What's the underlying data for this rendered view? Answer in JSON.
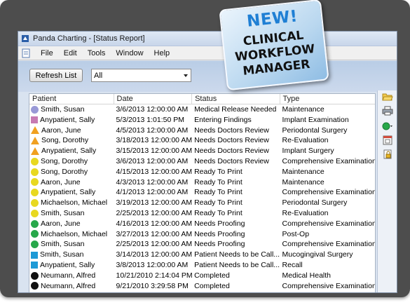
{
  "window": {
    "title": "Panda Charting - [Status Report]"
  },
  "menu": [
    "File",
    "Edit",
    "Tools",
    "Window",
    "Help"
  ],
  "toolbar": {
    "refresh_label": "Refresh List",
    "filter_value": "All"
  },
  "badge": {
    "line1": "NEW!",
    "line2": "CLINICAL",
    "line3": "WORKFLOW",
    "line4": "MANAGER"
  },
  "columns": [
    "Patient",
    "Date",
    "Status",
    "Type"
  ],
  "rows": [
    {
      "indicator": "circle",
      "color": "#9999d6",
      "patient": "Smith, Susan",
      "date": "3/6/2013 12:00:00 AM",
      "status": "Medical Release Needed",
      "type": "Maintenance"
    },
    {
      "indicator": "square",
      "color": "#c77ab3",
      "patient": "Anypatient, Sally",
      "date": "5/3/2013 1:01:50 PM",
      "status": "Entering  Findings",
      "type": "Implant Examination"
    },
    {
      "indicator": "triangle",
      "color": "#f0a020",
      "patient": "Aaron, June",
      "date": "4/5/2013 12:00:00 AM",
      "status": "Needs Doctors Review",
      "type": "Periodontal Surgery"
    },
    {
      "indicator": "triangle",
      "color": "#f0a020",
      "patient": "Song, Dorothy",
      "date": "3/18/2013 12:00:00 AM",
      "status": "Needs Doctors Review",
      "type": "Re-Evaluation"
    },
    {
      "indicator": "triangle",
      "color": "#f0a020",
      "patient": "Anypatient, Sally",
      "date": "3/15/2013 12:00:00 AM",
      "status": "Needs Doctors Review",
      "type": "Implant Surgery"
    },
    {
      "indicator": "circle",
      "color": "#e8d820",
      "patient": "Song, Dorothy",
      "date": "3/6/2013 12:00:00 AM",
      "status": "Needs Doctors Review",
      "type": "Comprehensive Examination"
    },
    {
      "indicator": "circle",
      "color": "#e8d820",
      "patient": "Song, Dorothy",
      "date": "4/15/2013 12:00:00 AM",
      "status": "Ready To Print",
      "type": "Maintenance"
    },
    {
      "indicator": "circle",
      "color": "#e8d820",
      "patient": "Aaron, June",
      "date": "4/3/2013 12:00:00 AM",
      "status": "Ready To Print",
      "type": "Maintenance"
    },
    {
      "indicator": "circle",
      "color": "#e8d820",
      "patient": "Anypatient, Sally",
      "date": "4/1/2013 12:00:00 AM",
      "status": "Ready To Print",
      "type": "Comprehensive Examination"
    },
    {
      "indicator": "circle",
      "color": "#e8d820",
      "patient": "Michaelson, Michael",
      "date": "3/19/2013 12:00:00 AM",
      "status": "Ready To Print",
      "type": "Periodontal Surgery"
    },
    {
      "indicator": "circle",
      "color": "#e8d820",
      "patient": "Smith, Susan",
      "date": "2/25/2013 12:00:00 AM",
      "status": "Ready To Print",
      "type": "Re-Evaluation"
    },
    {
      "indicator": "circle",
      "color": "#27a84a",
      "patient": "Aaron, June",
      "date": "4/16/2013 12:00:00 AM",
      "status": "Needs Proofing",
      "type": "Comprehensive Examination"
    },
    {
      "indicator": "circle",
      "color": "#27a84a",
      "patient": "Michaelson, Michael",
      "date": "3/27/2013 12:00:00 AM",
      "status": "Needs Proofing",
      "type": "Post-Op"
    },
    {
      "indicator": "circle",
      "color": "#27a84a",
      "patient": "Smith, Susan",
      "date": "2/25/2013 12:00:00 AM",
      "status": "Needs Proofing",
      "type": "Comprehensive Examination"
    },
    {
      "indicator": "square",
      "color": "#1e9ad6",
      "patient": "Smith, Susan",
      "date": "3/14/2013 12:00:00 AM",
      "status": "Patient Needs to be Call...",
      "type": "Mucogingival Surgery"
    },
    {
      "indicator": "square",
      "color": "#1e9ad6",
      "patient": "Anypatient, Sally",
      "date": "3/8/2013 12:00:00 AM",
      "status": "Patient Needs to be Call...",
      "type": "Recall"
    },
    {
      "indicator": "circle",
      "color": "#111111",
      "patient": "Neumann, Alfred",
      "date": "10/21/2010 2:14:04 PM",
      "status": "Completed",
      "type": "Medical Health"
    },
    {
      "indicator": "circle",
      "color": "#111111",
      "patient": "Neumann, Alfred",
      "date": "9/21/2010 3:29:58 PM",
      "status": "Completed",
      "type": "Comprehensive Examination"
    }
  ],
  "sidebar_icons": [
    "folder-open-icon",
    "printer-icon",
    "status-dot-icon",
    "calendar-icon",
    "lock-document-icon"
  ]
}
